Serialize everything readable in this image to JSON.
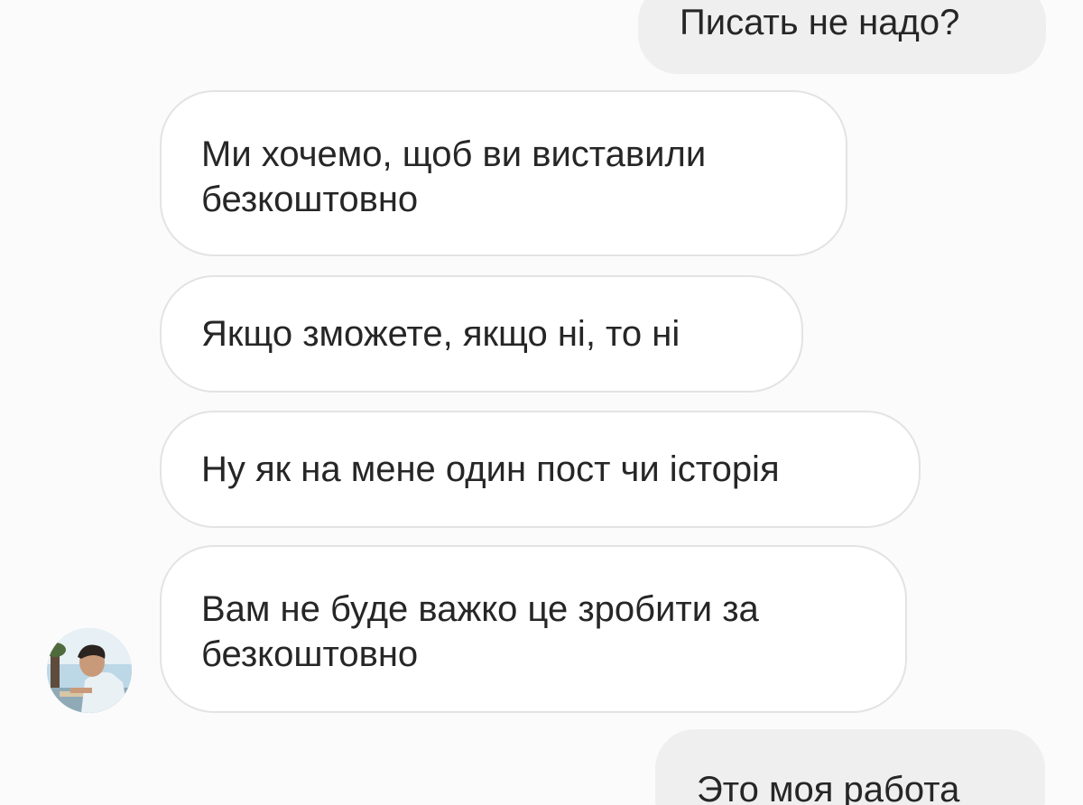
{
  "conversation": {
    "messages": [
      {
        "direction": "outgoing",
        "lines": [
          "Писать не надо?"
        ]
      },
      {
        "direction": "incoming",
        "lines": [
          "Ми хочемо, щоб ви виставили",
          "безкоштовно"
        ]
      },
      {
        "direction": "incoming",
        "lines": [
          "Якщо зможете, якщо ні, то ні"
        ]
      },
      {
        "direction": "incoming",
        "lines": [
          "Ну як на мене один пост чи історія"
        ]
      },
      {
        "direction": "incoming",
        "lines": [
          "Вам не буде важко це зробити за",
          "безкоштовно"
        ]
      },
      {
        "direction": "outgoing",
        "lines": [
          "Это моя работа"
        ]
      }
    ]
  },
  "colors": {
    "background": "#fbfbfb",
    "outgoing_bubble": "#efefef",
    "incoming_bubble": "#ffffff",
    "incoming_border": "#e3e3e3",
    "text": "#262626"
  },
  "icons": {
    "avatar": "contact-avatar-photo"
  }
}
